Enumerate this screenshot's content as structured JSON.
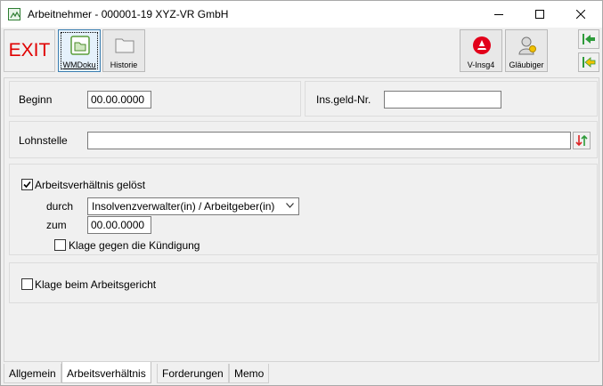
{
  "window": {
    "title": "Arbeitnehmer - 000001-19 XYZ-VR GmbH",
    "minimize_icon": "minimize-icon",
    "maximize_icon": "maximize-icon",
    "close_icon": "close-icon"
  },
  "toolbar": {
    "exit_label": "EXIT",
    "wmdoku_label": "WMDoku",
    "historie_label": "Historie",
    "vinsg_label": "V-Insg4",
    "glaeubiger_label": "Gläubiger",
    "exit_color": "#e00000",
    "arrow_color": "#2e9b3a"
  },
  "form": {
    "beginn_label": "Beginn",
    "beginn_value": "00.00.0000",
    "insgeld_label": "Ins.geld-Nr.",
    "insgeld_value": "",
    "lohnstelle_label": "Lohnstelle",
    "lohnstelle_value": "",
    "arbeitsverhaeltnis_geloest_label": "Arbeitsverhältnis gelöst",
    "arbeitsverhaeltnis_geloest_checked": true,
    "durch_label": "durch",
    "durch_value": "Insolvenzverwalter(in) / Arbeitgeber(in)",
    "zum_label": "zum",
    "zum_value": "00.00.0000",
    "klage_kuendigung_label": "Klage gegen die Kündigung",
    "klage_kuendigung_checked": false,
    "klage_arbeitsgericht_label": "Klage beim Arbeitsgericht",
    "klage_arbeitsgericht_checked": false
  },
  "tabs": [
    {
      "label": "Allgemein",
      "active": false
    },
    {
      "label": "Arbeitsverhältnis",
      "active": true
    },
    {
      "label": "Forderungen",
      "active": false
    },
    {
      "label": "Memo",
      "active": false
    }
  ]
}
